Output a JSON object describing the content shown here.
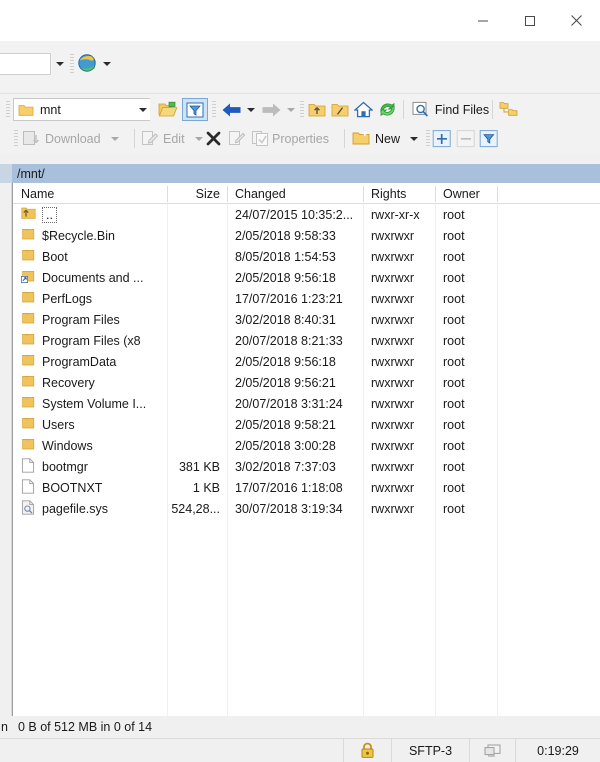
{
  "window": {
    "controls": [
      {
        "name": "minimize",
        "glyph": "minimize-icon"
      },
      {
        "name": "maximize",
        "glyph": "maximize-icon"
      },
      {
        "name": "close",
        "glyph": "close-icon"
      }
    ]
  },
  "session_bar": {
    "combo_value": "",
    "combo_placeholder": "",
    "session_icon": "globe-icon",
    "dropdown_icon": "chevron-down-icon"
  },
  "toolbar_top": {
    "path_value": "mnt",
    "path_icon": "folder-icon",
    "path_dropdown_icon": "chevron-down-icon",
    "buttons": [
      {
        "name": "open-directory",
        "icon": "open-folder-icon",
        "enabled": true
      },
      {
        "name": "filter",
        "icon": "filter-funnel-icon",
        "enabled": true,
        "active": true
      },
      {
        "name": "back",
        "icon": "arrow-left-icon",
        "enabled": true
      },
      {
        "name": "back-history",
        "icon": "chevron-down-icon",
        "enabled": true
      },
      {
        "name": "forward",
        "icon": "arrow-right-icon",
        "enabled": false
      },
      {
        "name": "forward-history",
        "icon": "chevron-down-icon",
        "enabled": false
      },
      {
        "name": "parent-directory",
        "icon": "folder-up-icon",
        "enabled": true
      },
      {
        "name": "root-directory",
        "icon": "folder-root-icon",
        "enabled": true
      },
      {
        "name": "home-directory",
        "icon": "home-icon",
        "enabled": true
      },
      {
        "name": "refresh",
        "icon": "refresh-icon",
        "enabled": true
      },
      {
        "name": "find-files",
        "icon": "magnifier-icon",
        "enabled": true
      },
      {
        "name": "synchronize-browsing",
        "icon": "sync-folders-icon",
        "enabled": true
      }
    ],
    "find_files_label": "Find Files"
  },
  "toolbar_second": {
    "download_label": "Download",
    "download_icon": "download-icon",
    "download_dropdown_icon": "chevron-down-icon",
    "edit_label": "Edit",
    "edit_icon": "edit-pencil-icon",
    "edit_dropdown_icon": "chevron-down-icon",
    "delete_icon": "delete-x-icon",
    "rename_icon": "rename-icon",
    "duplicate_icon": "duplicate-icon",
    "properties_label": "Properties",
    "properties_icon": "properties-icon",
    "new_label": "New",
    "new_icon": "new-folder-icon",
    "new_dropdown_icon": "chevron-down-icon",
    "select_plus_icon": "select-plus-icon",
    "select_minus_icon": "select-minus-icon",
    "select_filter_icon": "select-filter-icon"
  },
  "path_bar": {
    "current_path": "/mnt/"
  },
  "file_list": {
    "columns": [
      {
        "key": "name",
        "label": "Name",
        "align": "left"
      },
      {
        "key": "size",
        "label": "Size",
        "align": "right"
      },
      {
        "key": "changed",
        "label": "Changed",
        "align": "left"
      },
      {
        "key": "rights",
        "label": "Rights",
        "align": "left"
      },
      {
        "key": "owner",
        "label": "Owner",
        "align": "left"
      }
    ],
    "rows": [
      {
        "name": "..",
        "icon": "folder-up-icon",
        "focused": true,
        "size": "",
        "changed": "24/07/2015 10:35:2...",
        "rights": "rwxr-xr-x",
        "owner": "root"
      },
      {
        "name": "$Recycle.Bin",
        "icon": "folder-icon",
        "focused": false,
        "size": "",
        "changed": "2/05/2018 9:58:33",
        "rights": "rwxrwxr",
        "owner": "root"
      },
      {
        "name": "Boot",
        "icon": "folder-icon",
        "focused": false,
        "size": "",
        "changed": "8/05/2018 1:54:53",
        "rights": "rwxrwxr",
        "owner": "root"
      },
      {
        "name": "Documents and ...",
        "icon": "junction-icon",
        "focused": false,
        "size": "",
        "changed": "2/05/2018 9:56:18",
        "rights": "rwxrwxr",
        "owner": "root"
      },
      {
        "name": "PerfLogs",
        "icon": "folder-icon",
        "focused": false,
        "size": "",
        "changed": "17/07/2016 1:23:21",
        "rights": "rwxrwxr",
        "owner": "root"
      },
      {
        "name": "Program Files",
        "icon": "folder-icon",
        "focused": false,
        "size": "",
        "changed": "3/02/2018 8:40:31",
        "rights": "rwxrwxr",
        "owner": "root"
      },
      {
        "name": "Program Files (x8",
        "icon": "folder-icon",
        "focused": false,
        "size": "",
        "changed": "20/07/2018 8:21:33",
        "rights": "rwxrwxr",
        "owner": "root"
      },
      {
        "name": "ProgramData",
        "icon": "folder-icon",
        "focused": false,
        "size": "",
        "changed": "2/05/2018 9:56:18",
        "rights": "rwxrwxr",
        "owner": "root"
      },
      {
        "name": "Recovery",
        "icon": "folder-icon",
        "focused": false,
        "size": "",
        "changed": "2/05/2018 9:56:21",
        "rights": "rwxrwxr",
        "owner": "root"
      },
      {
        "name": "System Volume I...",
        "icon": "folder-icon",
        "focused": false,
        "size": "",
        "changed": "20/07/2018 3:31:24",
        "rights": "rwxrwxr",
        "owner": "root"
      },
      {
        "name": "Users",
        "icon": "folder-icon",
        "focused": false,
        "size": "",
        "changed": "2/05/2018 9:58:21",
        "rights": "rwxrwxr",
        "owner": "root"
      },
      {
        "name": "Windows",
        "icon": "folder-icon",
        "focused": false,
        "size": "",
        "changed": "2/05/2018 3:00:28",
        "rights": "rwxrwxr",
        "owner": "root"
      },
      {
        "name": "bootmgr",
        "icon": "file-icon",
        "focused": false,
        "size": "381 KB",
        "changed": "3/02/2018 7:37:03",
        "rights": "rwxrwxr",
        "owner": "root"
      },
      {
        "name": "BOOTNXT",
        "icon": "file-icon",
        "focused": false,
        "size": "1 KB",
        "changed": "17/07/2016 1:18:08",
        "rights": "rwxrwxr",
        "owner": "root"
      },
      {
        "name": "pagefile.sys",
        "icon": "system-file-icon",
        "focused": false,
        "size": "524,28...",
        "changed": "30/07/2018 3:19:34",
        "rights": "rwxrwxr",
        "owner": "root"
      }
    ]
  },
  "status": {
    "selection_lead": "n",
    "selection_summary": "0 B of 512 MB in 0 of 14",
    "lock_icon": "padlock-icon",
    "protocol": "SFTP-3",
    "monitor_icon": "remote-monitor-icon",
    "elapsed": "0:19:29"
  },
  "colors": {
    "pathbar_bg": "#a8c0dc",
    "toolbar_bg": "#f2f2f2",
    "panel_bg": "#ffffff",
    "disabled_text": "#a6a6a6",
    "folder_yellow": "#f7cf6a",
    "lock_yellow": "#d9a21b",
    "arrow_blue": "#1f5bbf"
  }
}
